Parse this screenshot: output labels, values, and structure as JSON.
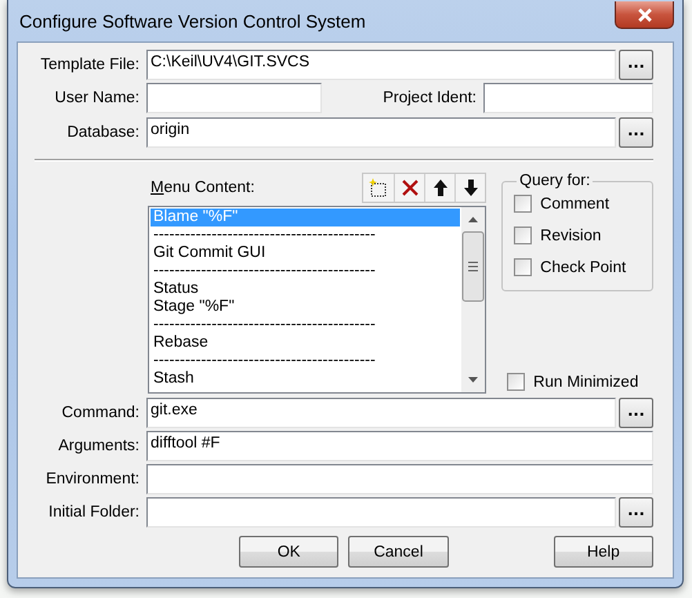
{
  "window": {
    "title": "Configure Software Version Control System"
  },
  "template_file": {
    "label": "Template File:",
    "value": "C:\\Keil\\UV4\\GIT.SVCS",
    "browse": "..."
  },
  "user_name": {
    "label": "User Name:"
  },
  "project_ident": {
    "label": "Project Ident:"
  },
  "database": {
    "label": "Database:",
    "value": "origin",
    "browse": "..."
  },
  "menu_content": {
    "label": "Menu Content:",
    "items": [
      {
        "text": "Blame \"%F\"",
        "selected": true
      },
      {
        "text": "------------------------------------------",
        "selected": false
      },
      {
        "text": "Git Commit GUI",
        "selected": false
      },
      {
        "text": "------------------------------------------",
        "selected": false
      },
      {
        "text": "Status",
        "selected": false
      },
      {
        "text": "Stage \"%F\"",
        "selected": false
      },
      {
        "text": "------------------------------------------",
        "selected": false
      },
      {
        "text": "Rebase",
        "selected": false
      },
      {
        "text": "------------------------------------------",
        "selected": false
      },
      {
        "text": "Stash",
        "selected": false
      }
    ]
  },
  "query_for": {
    "title": "Query for:",
    "options": [
      {
        "label": "Comment",
        "checked": false
      },
      {
        "label": "Revision",
        "checked": false
      },
      {
        "label": "Check Point",
        "checked": false
      }
    ]
  },
  "run_minimized": {
    "label": "Run Minimized",
    "checked": false
  },
  "bottom_fields": [
    {
      "label": "Command:",
      "value": "git.exe",
      "browse": "..."
    },
    {
      "label": "Arguments:",
      "value": "difftool #F"
    },
    {
      "label": "Environment:"
    },
    {
      "label": "Initial Folder:",
      "browse": "..."
    }
  ],
  "buttons": [
    {
      "label": "OK",
      "kind": "ok"
    },
    {
      "label": "Cancel",
      "kind": "cancel"
    },
    {
      "label": "Help",
      "kind": "help"
    }
  ]
}
